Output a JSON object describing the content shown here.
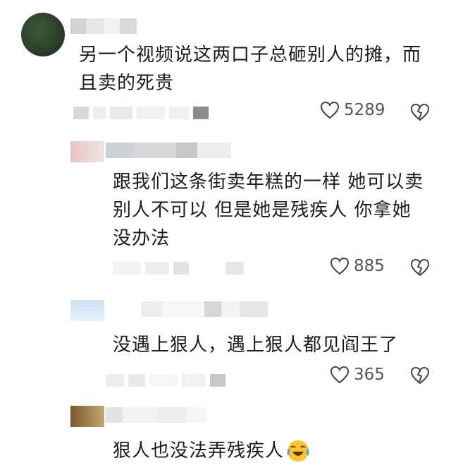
{
  "comments": [
    {
      "text": "另一个视频说这两口子总砸别人的摊，而且卖的死贵",
      "likes": "5289"
    },
    {
      "text": "跟我们这条街卖年糕的一样 她可以卖别人不可以 但是她是残疾人 你拿她没办法",
      "likes": "885"
    },
    {
      "text": "没遇上狠人，遇上狠人都见阎王了",
      "likes": "365"
    },
    {
      "text": "狠人也没法弄残疾人",
      "emoji": "crying-laughing-emoji"
    }
  ],
  "icons": {
    "like": "heart-outline-icon",
    "dislike": "broken-heart-icon"
  },
  "colors": {
    "icon": "#444444",
    "count": "#555555"
  }
}
